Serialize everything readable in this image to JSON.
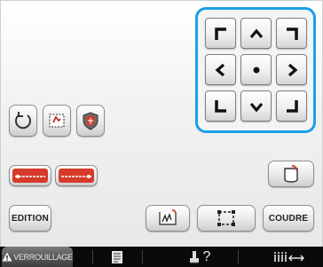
{
  "buttons": {
    "edition_label": "EDITION",
    "coudre_label": "COUDRE"
  },
  "bottom_bar": {
    "lock_label": "VERROUILLAGE",
    "help_label": "?"
  },
  "colors": {
    "accent_frame": "#1aa0e8",
    "bottom_bar_bg": "#0a0a0a"
  },
  "icons": {
    "move_pad": [
      "corner-up-left-icon",
      "arrow-up-icon",
      "corner-up-right-icon",
      "arrow-left-icon",
      "center-dot-icon",
      "arrow-right-icon",
      "corner-down-left-icon",
      "arrow-down-icon",
      "corner-down-right-icon"
    ],
    "tools": [
      "rotate-icon",
      "trial-frame-icon",
      "density-shield-icon",
      "thread-start-icon",
      "thread-end-icon",
      "embroider-pocket-icon",
      "sew-stitch-icon",
      "layout-frame-icon"
    ],
    "bottom": [
      "warning-icon",
      "page-list-icon",
      "machine-help-icon",
      "thread-tension-icon"
    ]
  }
}
